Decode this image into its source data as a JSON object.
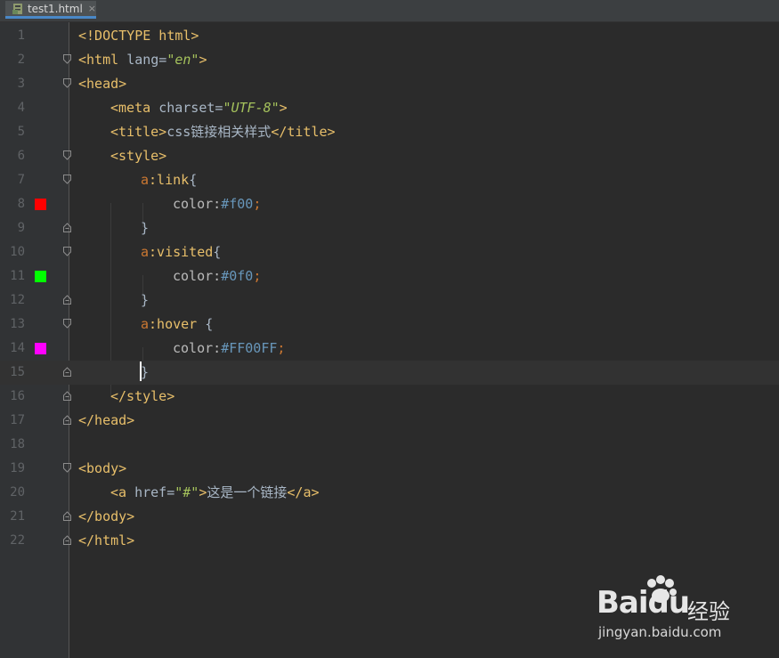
{
  "tab": {
    "title": "test1.html",
    "close": "×"
  },
  "colors": {
    "line8_swatch": "#ff0000",
    "line11_swatch": "#00ff00",
    "line14_swatch": "#ff00ff"
  },
  "lines": [
    {
      "num": "1"
    },
    {
      "num": "2"
    },
    {
      "num": "3"
    },
    {
      "num": "4"
    },
    {
      "num": "5"
    },
    {
      "num": "6"
    },
    {
      "num": "7"
    },
    {
      "num": "8"
    },
    {
      "num": "9"
    },
    {
      "num": "10"
    },
    {
      "num": "11"
    },
    {
      "num": "12"
    },
    {
      "num": "13"
    },
    {
      "num": "14"
    },
    {
      "num": "15"
    },
    {
      "num": "16"
    },
    {
      "num": "17"
    },
    {
      "num": "18"
    },
    {
      "num": "19"
    },
    {
      "num": "20"
    },
    {
      "num": "21"
    },
    {
      "num": "22"
    }
  ],
  "code": {
    "l1": "<!DOCTYPE html>",
    "l2_open": "<html ",
    "l2_attr": "lang=",
    "l2_val": "\"en\"",
    "l2_close": ">",
    "l3": "<head>",
    "l4_open": "<meta ",
    "l4_attr": "charset=",
    "l4_val": "\"UTF-8\"",
    "l4_close": ">",
    "l5_open": "<title>",
    "l5_text": "css链接相关样式",
    "l5_close": "</title>",
    "l6": "<style>",
    "l7_sel": "a",
    "l7_pseudo": ":link",
    "l7_brace": "{",
    "l8_prop": "color:",
    "l8_val": "#f00",
    "l8_semi": ";",
    "l9": "}",
    "l10_sel": "a",
    "l10_pseudo": ":visited",
    "l10_brace": "{",
    "l11_prop": "color:",
    "l11_val": "#0f0",
    "l11_semi": ";",
    "l12": "}",
    "l13_sel": "a",
    "l13_pseudo": ":hover ",
    "l13_brace": "{",
    "l14_prop": "color:",
    "l14_val": "#FF00FF",
    "l14_semi": ";",
    "l15": "}",
    "l16": "</style>",
    "l17": "</head>",
    "l19": "<body>",
    "l20_open": "<a ",
    "l20_attr": "href=",
    "l20_val": "\"#\"",
    "l20_gt": ">",
    "l20_text": "这是一个链接",
    "l20_close": "</a>",
    "l21": "</body>",
    "l22": "</html>"
  },
  "watermark": {
    "logo": "Baidu",
    "cn": "经验",
    "url": "jingyan.baidu.com"
  }
}
